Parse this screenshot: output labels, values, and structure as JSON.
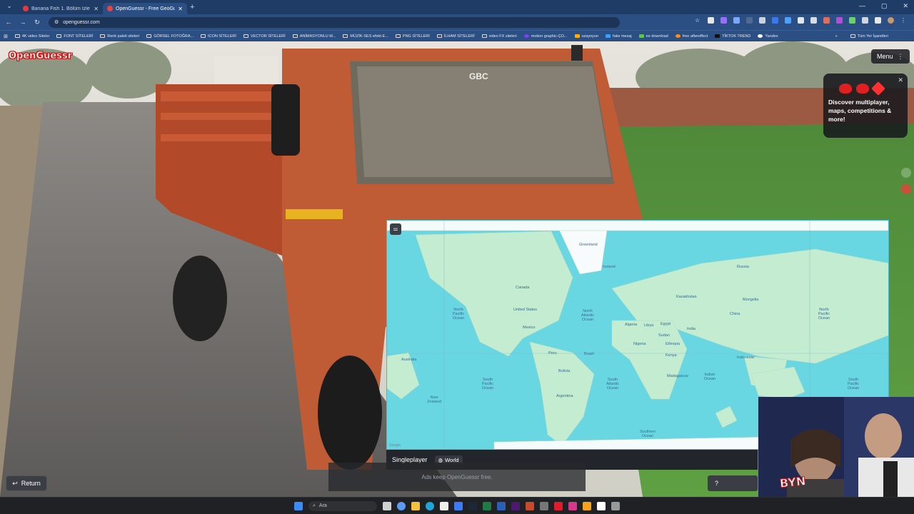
{
  "browser": {
    "tabs": [
      {
        "title": "Banana Fish 1. Bölüm İzle - Ani",
        "active": false,
        "favicon_color": "#e33b3b"
      },
      {
        "title": "OpenGuessr - Free GeoGu",
        "active": true,
        "favicon_color": "#e84444"
      }
    ],
    "url": "openguessr.com",
    "bookmarks": [
      {
        "label": "4K video Siteler",
        "type": "folder"
      },
      {
        "label": "FONT SİTELERİ",
        "type": "folder"
      },
      {
        "label": "Renk paleti siteleri",
        "type": "folder"
      },
      {
        "label": "GÖRSEL FOTOĞRA...",
        "type": "folder"
      },
      {
        "label": "ICON SİTELERİ",
        "type": "folder"
      },
      {
        "label": "VECTOR SİTELERİ",
        "type": "folder"
      },
      {
        "label": "ANİMASYONLU M...",
        "type": "folder"
      },
      {
        "label": "MÜZİK-SES efekt-E...",
        "type": "folder"
      },
      {
        "label": "PNG SİTELERİ",
        "type": "folder"
      },
      {
        "label": "İLHAM SİTELERİ",
        "type": "folder"
      },
      {
        "label": "video FX siteleri",
        "type": "folder"
      },
      {
        "label": "motion graphic-ÇO...",
        "type": "link"
      },
      {
        "label": "uzayoyun",
        "type": "link"
      },
      {
        "label": "fake mesaj",
        "type": "link"
      },
      {
        "label": "ee download",
        "type": "link"
      },
      {
        "label": "free aftereffect",
        "type": "link"
      },
      {
        "label": "TİKTOK TREND",
        "type": "link"
      },
      {
        "label": "Yandex",
        "type": "link"
      }
    ],
    "bookmarks_more": "»",
    "all_bookmarks": "Tüm Yer İşaretleri"
  },
  "game": {
    "logo": "OpenGuessr",
    "menu_label": "Menu",
    "promo": {
      "text": "Discover multiplayer, maps, competitions & more!"
    },
    "truck_text": "GBC",
    "map": {
      "labels": [
        {
          "text": "Greenland"
        },
        {
          "text": "Iceland"
        },
        {
          "text": "Canada"
        },
        {
          "text": "United States"
        },
        {
          "text": "Mexico"
        },
        {
          "text": "North Pacific Ocean"
        },
        {
          "text": "North Atlantic Ocean"
        },
        {
          "text": "North Pacific Ocean"
        },
        {
          "text": "Brazil"
        },
        {
          "text": "Peru"
        },
        {
          "text": "Bolivia"
        },
        {
          "text": "Argentina"
        },
        {
          "text": "South Pacific Ocean"
        },
        {
          "text": "South Atlantic Ocean"
        },
        {
          "text": "South Pacific Ocean"
        },
        {
          "text": "Indian Ocean"
        },
        {
          "text": "Russia"
        },
        {
          "text": "Kazakhstan"
        },
        {
          "text": "Mongolia"
        },
        {
          "text": "China"
        },
        {
          "text": "India"
        },
        {
          "text": "Algeria"
        },
        {
          "text": "Libya"
        },
        {
          "text": "Egypt"
        },
        {
          "text": "Sudan"
        },
        {
          "text": "Nigeria"
        },
        {
          "text": "Ethiopia"
        },
        {
          "text": "Kenya"
        },
        {
          "text": "Madagascar"
        },
        {
          "text": "Australia"
        },
        {
          "text": "Indonesia"
        },
        {
          "text": "Southern Ocean"
        },
        {
          "text": "New Zealand"
        }
      ],
      "attribution": "Google"
    },
    "mode": {
      "label": "Singleplayer",
      "map_name": "World"
    },
    "ads_text": "Ads keep OpenGuessr free.",
    "return_label": "Return",
    "help_label": "?",
    "webcam_badge": "BYN"
  },
  "taskbar": {
    "search_placeholder": "Ara"
  }
}
